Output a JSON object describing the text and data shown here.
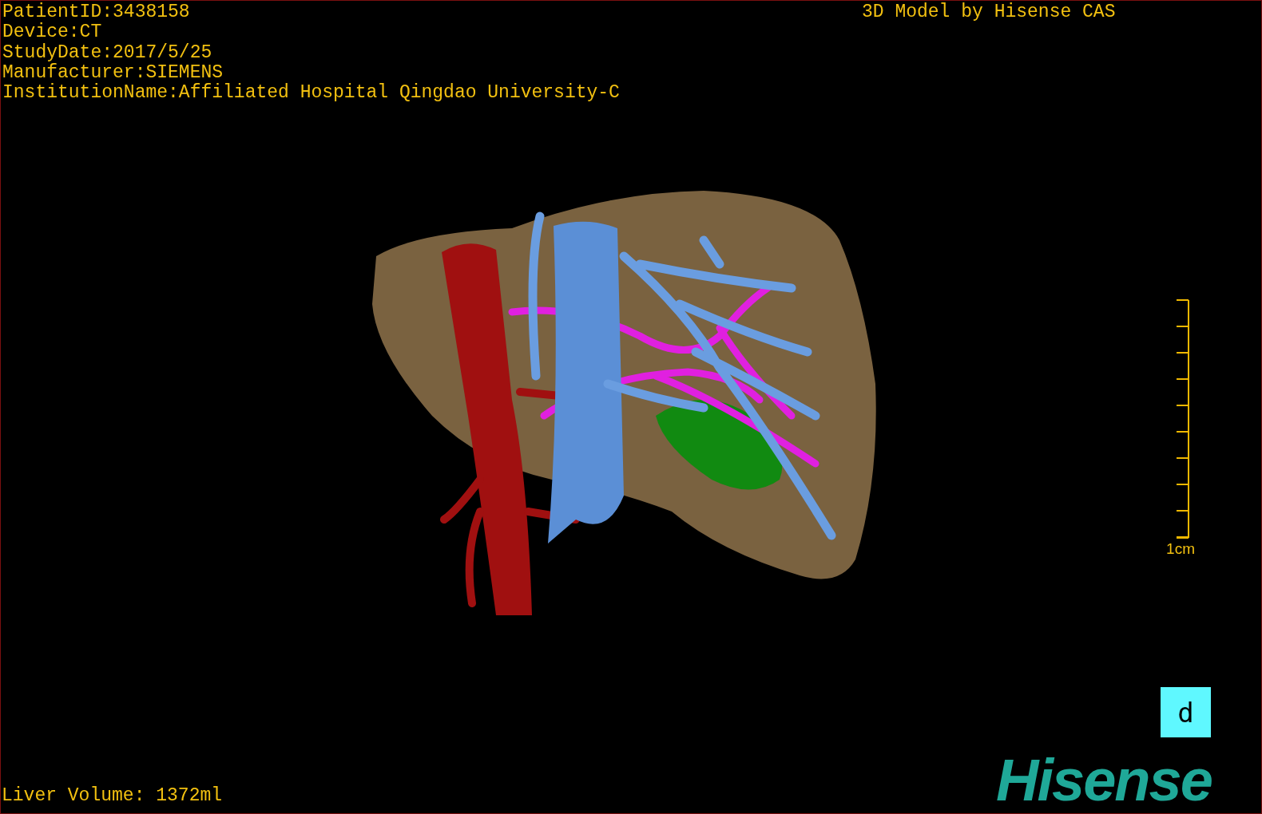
{
  "info_lines": [
    "PatientID:3438158",
    "Device:CT",
    "StudyDate:2017/5/25",
    "Manufacturer:SIEMENS",
    "InstitutionName:Affiliated Hospital Qingdao University-C"
  ],
  "model_credit": "3D Model by Hisense CAS",
  "scale": {
    "label": "1cm"
  },
  "view_button": {
    "label": "d"
  },
  "logo": "Hisense",
  "liver_volume": "Liver Volume: 1372ml"
}
